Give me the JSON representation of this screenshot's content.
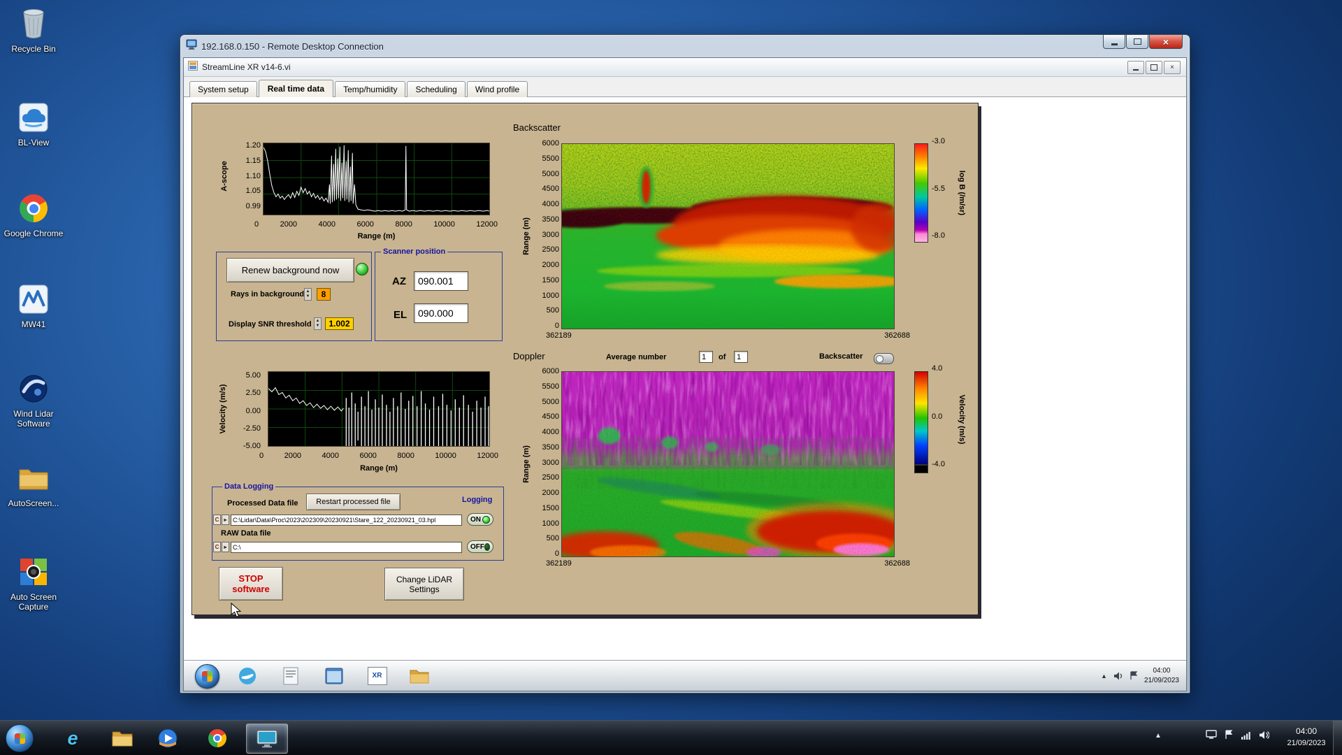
{
  "desktop": {
    "icons": [
      {
        "label": "Recycle Bin"
      },
      {
        "label": "BL-View"
      },
      {
        "label": "Google Chrome"
      },
      {
        "label": "MW41"
      },
      {
        "label": "Wind Lidar Software"
      },
      {
        "label": "AutoScreen..."
      },
      {
        "label": "Auto Screen Capture"
      }
    ]
  },
  "rdp": {
    "title": "192.168.0.150 - Remote Desktop Connection"
  },
  "app": {
    "title": "StreamLine XR v14-6.vi",
    "tabs": [
      {
        "label": "System setup",
        "active": false
      },
      {
        "label": "Real time data",
        "active": true
      },
      {
        "label": "Temp/humidity",
        "active": false
      },
      {
        "label": "Scheduling",
        "active": false
      },
      {
        "label": "Wind profile",
        "active": false
      }
    ]
  },
  "ascope": {
    "ylabel": "A-scope",
    "xlabel": "Range (m)",
    "yticks": [
      "1.20",
      "1.15",
      "1.10",
      "1.05",
      "0.99"
    ],
    "xticks": [
      "0",
      "2000",
      "4000",
      "6000",
      "8000",
      "10000",
      "12000"
    ]
  },
  "velocity_plot": {
    "ylabel": "Velocity (m/s)",
    "xlabel": "Range (m)",
    "yticks": [
      "5.00",
      "2.50",
      "0.00",
      "-2.50",
      "-5.00"
    ],
    "xticks": [
      "0",
      "2000",
      "4000",
      "6000",
      "8000",
      "10000",
      "12000"
    ]
  },
  "backscatter": {
    "title": "Backscatter",
    "ylabel": "Range (m)",
    "yticks": [
      "6000",
      "5500",
      "5000",
      "4500",
      "4000",
      "3500",
      "3000",
      "2500",
      "2000",
      "1500",
      "1000",
      "500",
      "0"
    ],
    "xticks": [
      "362189",
      "362688"
    ],
    "colorbar_label": "log B (/m/sr)",
    "colorbar_ticks": [
      "-3.0",
      "-5.5",
      "-8.0"
    ]
  },
  "doppler": {
    "title": "Doppler",
    "ylabel": "Range (m)",
    "yticks": [
      "6000",
      "5500",
      "5000",
      "4500",
      "4000",
      "3500",
      "3000",
      "2500",
      "2000",
      "1500",
      "1000",
      "500",
      "0"
    ],
    "xticks": [
      "362189",
      "362688"
    ],
    "colorbar_label": "Velocity (m/s)",
    "colorbar_ticks": [
      "4.0",
      "0.0",
      "-4.0"
    ],
    "average_label": "Average number",
    "average_value": "1",
    "of_label": "of",
    "average_value2": "1",
    "backscatter_toggle_label": "Backscatter"
  },
  "controls": {
    "renew_button": "Renew background now",
    "rays_label": "Rays in background",
    "rays_value": "8",
    "snr_label": "Display SNR threshold",
    "snr_value": "1.002",
    "scanner_title": "Scanner position",
    "az_label": "AZ",
    "az_value": "090.001",
    "el_label": "EL",
    "el_value": "090.000"
  },
  "logging": {
    "title": "Data Logging",
    "processed_label": "Processed Data file",
    "restart_button": "Restart processed file",
    "logging_label": "Logging",
    "processed_path": "C:\\Lidar\\Data\\Proc\\2023\\202309\\20230921\\Stare_122_20230921_03.hpl",
    "processed_toggle": "ON",
    "raw_label": "RAW Data file",
    "raw_path": "C:\\",
    "raw_toggle": "OFF"
  },
  "footer": {
    "stop_line1": "STOP",
    "stop_line2": "software",
    "change_line1": "Change LiDAR",
    "change_line2": "Settings"
  },
  "remote_taskbar": {
    "xr_label": "XR",
    "clock_time": "04:00",
    "clock_date": "21/09/2023"
  },
  "taskbar": {
    "ie_glyph": "e",
    "clock_time": "04:00",
    "clock_date": "21/09/2023"
  }
}
